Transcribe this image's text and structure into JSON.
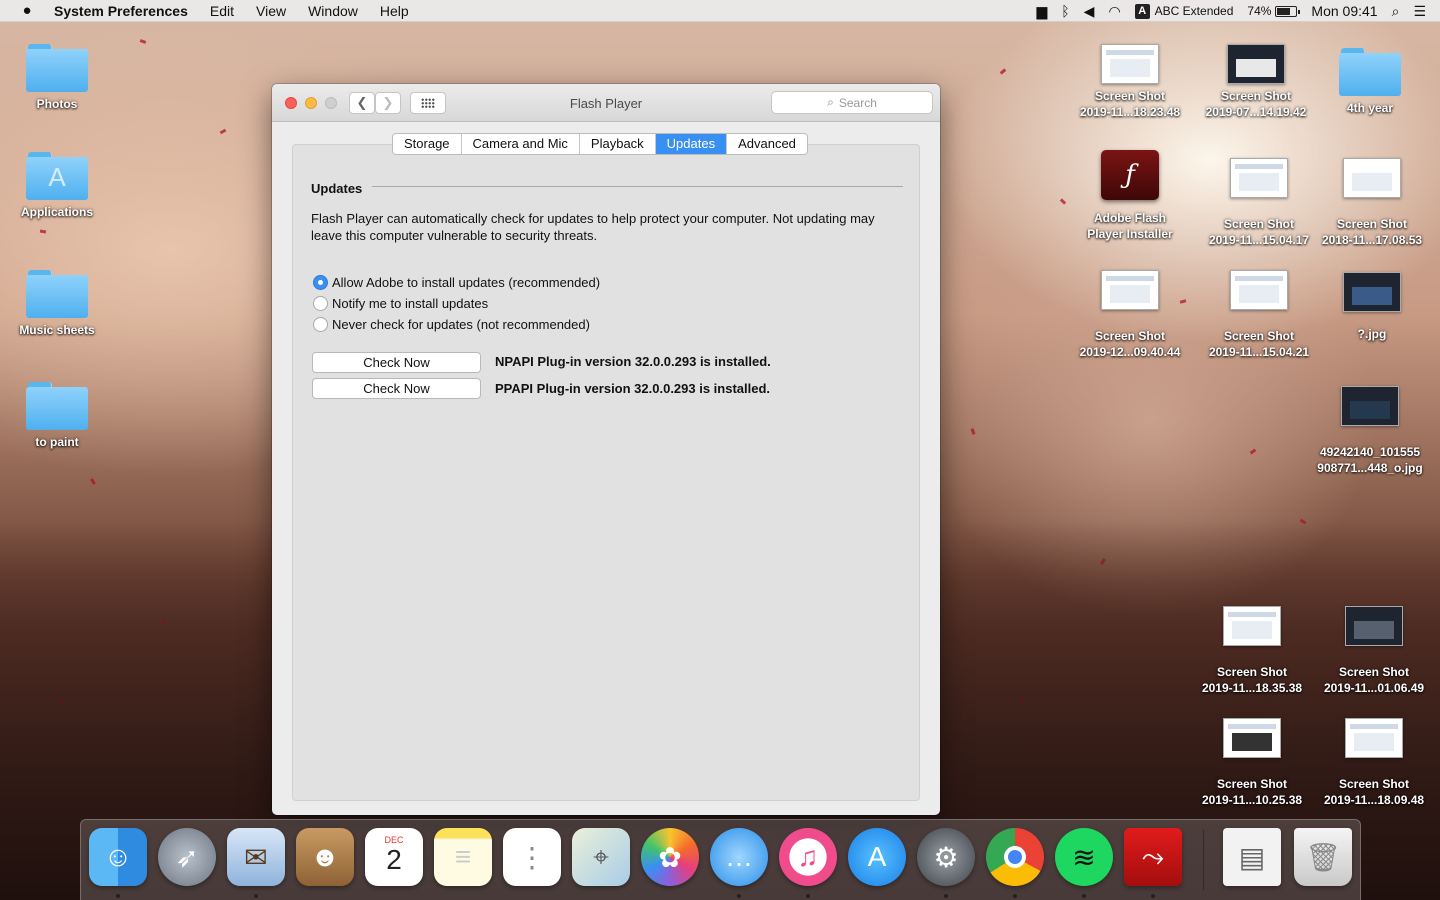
{
  "menubar": {
    "app_name": "System Preferences",
    "menus": [
      "Edit",
      "View",
      "Window",
      "Help"
    ],
    "input_source": "ABC Extended",
    "input_badge": "A",
    "battery_percent": "74%",
    "battery_level": 0.74,
    "clock": "Mon 09:41"
  },
  "desktop": {
    "left_items": [
      {
        "label": "Photos",
        "icon": "folder-icon"
      },
      {
        "label": "Applications",
        "icon": "applications-folder-icon"
      },
      {
        "label": "Music sheets",
        "icon": "folder-icon"
      },
      {
        "label": "to paint",
        "icon": "folder-icon"
      }
    ],
    "right_items": [
      {
        "line1": "Screen Shot",
        "line2": "2019-11...18.23.48"
      },
      {
        "line1": "Screen Shot",
        "line2": "2019-07...14.19.42"
      },
      {
        "line1": "4th year",
        "line2": ""
      },
      {
        "line1": "Adobe Flash",
        "line2": "Player Installer"
      },
      {
        "line1": "Screen Shot",
        "line2": "2019-11...15.04.17"
      },
      {
        "line1": "Screen Shot",
        "line2": "2018-11...17.08.53"
      },
      {
        "line1": "Screen Shot",
        "line2": "2019-12...09.40.44"
      },
      {
        "line1": "Screen Shot",
        "line2": "2019-11...15.04.21"
      },
      {
        "line1": "?.jpg",
        "line2": ""
      },
      {
        "line1": "49242140_101555",
        "line2": "908771...448_o.jpg"
      },
      {
        "line1": "Screen Shot",
        "line2": "2019-11...18.35.38"
      },
      {
        "line1": "Screen Shot",
        "line2": "2019-11...01.06.49"
      },
      {
        "line1": "Screen Shot",
        "line2": "2019-11...10.25.38"
      },
      {
        "line1": "Screen Shot",
        "line2": "2019-11...18.09.48"
      }
    ]
  },
  "window": {
    "title": "Flash Player",
    "search_placeholder": "Search",
    "tabs": [
      "Storage",
      "Camera and Mic",
      "Playback",
      "Updates",
      "Advanced"
    ],
    "active_tab": "Updates",
    "section_title": "Updates",
    "description": "Flash Player can automatically check for updates to help protect your computer. Not updating may leave this computer vulnerable to security threats.",
    "options": [
      {
        "label": "Allow Adobe to install updates (recommended)",
        "selected": true
      },
      {
        "label": "Notify me to install updates",
        "selected": false
      },
      {
        "label": "Never check for updates (not recommended)",
        "selected": false
      }
    ],
    "plugins": [
      {
        "button": "Check Now",
        "status": "NPAPI Plug-in version 32.0.0.293 is installed."
      },
      {
        "button": "Check Now",
        "status": "PPAPI Plug-in version 32.0.0.293 is installed."
      }
    ]
  },
  "dock": {
    "calendar_month": "DEC",
    "calendar_day": "2",
    "apps": [
      "finder-icon",
      "launchpad-icon",
      "mail-icon",
      "contacts-icon",
      "calendar-icon",
      "notes-icon",
      "reminders-icon",
      "maps-icon",
      "photos-icon",
      "messages-icon",
      "itunes-icon",
      "app-store-icon",
      "system-preferences-icon",
      "chrome-icon",
      "spotify-icon",
      "acrobat-icon",
      "downloads-stack-icon",
      "trash-icon"
    ]
  },
  "colors": {
    "accent": "#3a8ff2",
    "close": "#fc605b",
    "minimize": "#fdbc40"
  }
}
